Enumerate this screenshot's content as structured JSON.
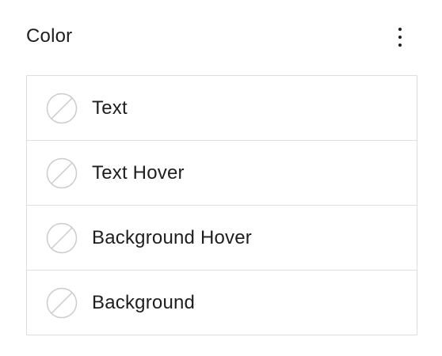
{
  "panel": {
    "title": "Color",
    "options_icon": "more-vertical-icon"
  },
  "items": [
    {
      "label": "Text",
      "swatch_icon": "no-color-icon"
    },
    {
      "label": "Text Hover",
      "swatch_icon": "no-color-icon"
    },
    {
      "label": "Background Hover",
      "swatch_icon": "no-color-icon"
    },
    {
      "label": "Background",
      "swatch_icon": "no-color-icon"
    }
  ],
  "colors": {
    "text": "#1e1e1e",
    "border": "#dddddd",
    "swatch_stroke": "#cccccc"
  }
}
